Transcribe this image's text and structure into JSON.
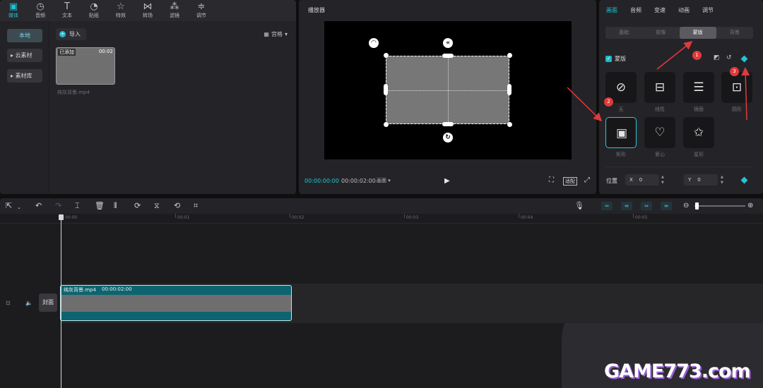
{
  "media": {
    "tabs": [
      {
        "label": "媒体",
        "icon": "media-icon"
      },
      {
        "label": "音频",
        "icon": "audio-icon"
      },
      {
        "label": "文本",
        "icon": "text-icon"
      },
      {
        "label": "贴纸",
        "icon": "sticker-icon"
      },
      {
        "label": "特效",
        "icon": "effects-icon"
      },
      {
        "label": "转场",
        "icon": "transition-icon"
      },
      {
        "label": "滤镜",
        "icon": "filter-icon"
      },
      {
        "label": "调节",
        "icon": "adjust-icon"
      }
    ],
    "sidebar": [
      {
        "label": "本地"
      },
      {
        "label": "云素材"
      },
      {
        "label": "素材库"
      }
    ],
    "import_label": "导入",
    "view_label": "宫格",
    "item": {
      "added": "已添加",
      "duration": "00:02",
      "name": "纯灰背景.mp4"
    }
  },
  "player": {
    "title": "播放器",
    "current_time": "00:00:00:00",
    "total_time": "00:00:02:00",
    "ratio_label": "画面",
    "fit_label": "适配"
  },
  "inspector": {
    "tabs": [
      {
        "label": "画面"
      },
      {
        "label": "音频"
      },
      {
        "label": "变速"
      },
      {
        "label": "动画"
      },
      {
        "label": "调节"
      }
    ],
    "sub_tabs": [
      {
        "label": "基础"
      },
      {
        "label": "抠像"
      },
      {
        "label": "蒙版"
      },
      {
        "label": "背景"
      }
    ],
    "mask_toggle_label": "蒙版",
    "masks": [
      {
        "label": "无",
        "icon": "none-icon"
      },
      {
        "label": "线性",
        "icon": "linear-mask-icon"
      },
      {
        "label": "镜面",
        "icon": "mirror-mask-icon"
      },
      {
        "label": "圆形",
        "icon": "circle-mask-icon"
      },
      {
        "label": "矩形",
        "icon": "rectangle-mask-icon"
      },
      {
        "label": "爱心",
        "icon": "heart-mask-icon"
      },
      {
        "label": "星形",
        "icon": "star-mask-icon"
      }
    ],
    "position": {
      "label": "位置",
      "x_label": "X",
      "x_value": "0",
      "y_label": "Y",
      "y_value": "0"
    }
  },
  "annotations": [
    "1",
    "2",
    "3"
  ],
  "timeline": {
    "ruler": [
      "00:00",
      "00:01",
      "00:02",
      "00:03",
      "00:04",
      "00:05"
    ],
    "cover_label": "封面",
    "clip": {
      "name": "纯灰背景.mp4",
      "duration": "00:00:02:00"
    }
  },
  "watermark": "GAME773.com",
  "colors": {
    "accent": "#22c4d4",
    "annotation": "#e03a3a",
    "clip": "#0d6470"
  }
}
